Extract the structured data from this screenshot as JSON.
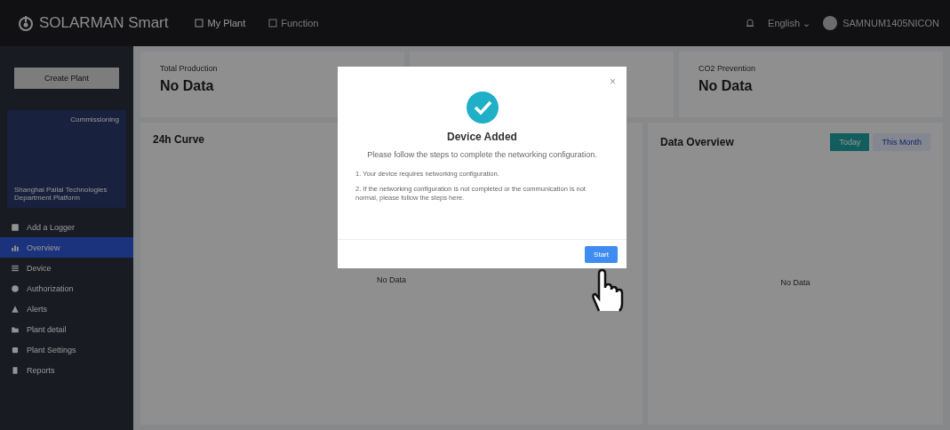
{
  "topbar": {
    "brand": "SOLARMAN Smart",
    "nav": [
      {
        "label": "My Plant",
        "selected": true
      },
      {
        "label": "Function",
        "selected": false
      }
    ],
    "language": "English",
    "language_caret": "⌄",
    "user": "SAMNUM1405NICON"
  },
  "sidebar": {
    "create_button": "Create Plant",
    "plant": {
      "status": "Commissioning",
      "name": "Shanghai Pailai Technologies Department Platform"
    },
    "items": [
      {
        "label": "Add a Logger",
        "selected": false
      },
      {
        "label": "Overview",
        "selected": true
      },
      {
        "label": "Device",
        "selected": false
      },
      {
        "label": "Authorization",
        "selected": false
      },
      {
        "label": "Alerts",
        "selected": false
      },
      {
        "label": "Plant detail",
        "selected": false
      },
      {
        "label": "Plant Settings",
        "selected": false
      },
      {
        "label": "Reports",
        "selected": false
      }
    ]
  },
  "stats": [
    {
      "label": "Total Production",
      "value": "No Data"
    },
    {
      "label": "CO2 Prevention",
      "value": "No Data"
    }
  ],
  "curve_panel": {
    "title": "24h Curve",
    "empty": "No Data"
  },
  "overview_panel": {
    "title": "Data Overview",
    "tabs": [
      {
        "label": "Today",
        "selected": true
      },
      {
        "label": "This Month",
        "selected": false
      }
    ],
    "empty": "No Data"
  },
  "dialog": {
    "title": "Device Added",
    "subtitle": "Please follow the steps to complete the networking configuration.",
    "steps": [
      "1. Your device requires networking configuration.",
      "2. If the networking configuration is not completed or the communication is not normal, please follow the steps here."
    ],
    "button": "Start",
    "close": "×"
  }
}
